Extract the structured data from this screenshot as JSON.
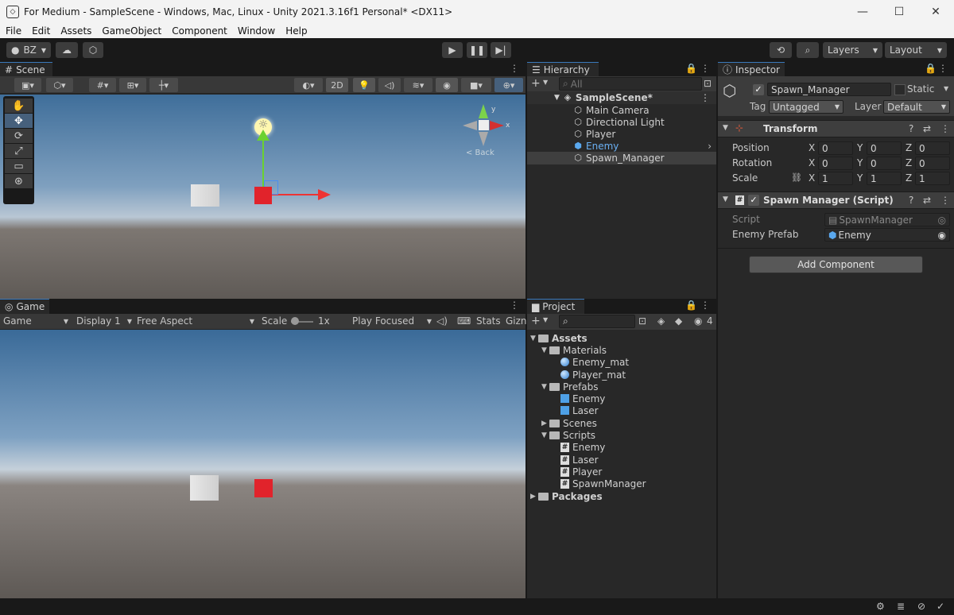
{
  "window": {
    "title": "For Medium - SampleScene - Windows, Mac, Linux - Unity 2021.3.16f1 Personal* <DX11>",
    "minimize": "—",
    "maximize": "☐",
    "close": "✕"
  },
  "menu": [
    "File",
    "Edit",
    "Assets",
    "GameObject",
    "Component",
    "Window",
    "Help"
  ],
  "toolbar": {
    "account": "BZ",
    "layers": "Layers",
    "layout": "Layout"
  },
  "scene": {
    "tab": "Scene",
    "btn_2d": "2D",
    "back_label": "< Back",
    "gizmo_y": "y",
    "gizmo_x": "x"
  },
  "game": {
    "tab": "Game",
    "mode": "Game",
    "display": "Display 1",
    "aspect": "Free Aspect",
    "scale_label": "Scale",
    "scale_value": "1x",
    "play_mode": "Play Focused",
    "stats": "Stats",
    "gizmos": "Gizn"
  },
  "hierarchy": {
    "tab": "Hierarchy",
    "search_placeholder": "All",
    "scene": "SampleScene*",
    "items": [
      "Main Camera",
      "Directional Light",
      "Player",
      "Enemy",
      "Spawn_Manager"
    ]
  },
  "project": {
    "tab": "Project",
    "hidden_count": "4",
    "tree": {
      "assets": "Assets",
      "materials": "Materials",
      "enemy_mat": "Enemy_mat",
      "player_mat": "Player_mat",
      "prefabs": "Prefabs",
      "enemy": "Enemy",
      "laser": "Laser",
      "scenes": "Scenes",
      "scripts": "Scripts",
      "s_enemy": "Enemy",
      "s_laser": "Laser",
      "s_player": "Player",
      "s_spawn": "SpawnManager",
      "packages": "Packages"
    }
  },
  "inspector": {
    "tab": "Inspector",
    "object_name": "Spawn_Manager",
    "static_label": "Static",
    "tag_label": "Tag",
    "tag_value": "Untagged",
    "layer_label": "Layer",
    "layer_value": "Default",
    "transform": {
      "title": "Transform",
      "position": "Position",
      "rotation": "Rotation",
      "scale": "Scale",
      "x": "X",
      "y": "Y",
      "z": "Z",
      "pos": [
        "0",
        "0",
        "0"
      ],
      "rot": [
        "0",
        "0",
        "0"
      ],
      "scl": [
        "1",
        "1",
        "1"
      ]
    },
    "script_comp": {
      "title": "Spawn Manager (Script)",
      "script_label": "Script",
      "script_value": "SpawnManager",
      "prefab_label": "Enemy Prefab",
      "prefab_value": "Enemy"
    },
    "add_component": "Add Component"
  },
  "colors": {
    "accent": "#3a79bb",
    "selected_text": "#6ab0f3",
    "enemy": "#e02020"
  }
}
